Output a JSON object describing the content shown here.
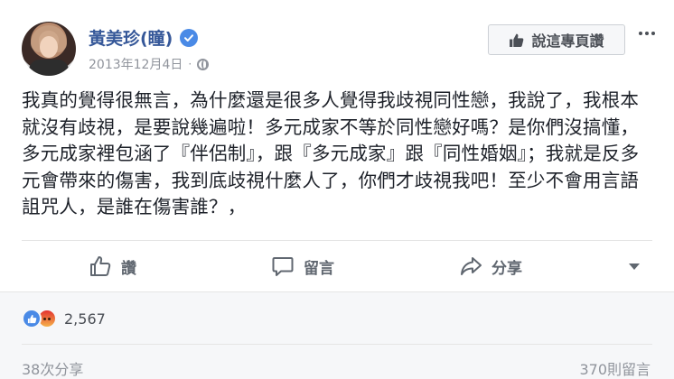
{
  "page": {
    "name": "黃美珍(瞳)",
    "date": "2013年12月4日",
    "separator": "·",
    "like_page_label": "說這專頁讚"
  },
  "post": {
    "text": "我真的覺得很無言，為什麼還是很多人覺得我歧視同性戀，我說了，我根本就沒有歧視，是要說幾遍啦！多元成家不等於同性戀好嗎？是你們沒搞懂，多元成家裡包涵了『伴侶制』，跟『多元成家』跟『同性婚姻』；我就是反多元會帶來的傷害，我到底歧視什麼人了，你們才歧視我吧！至少不會用言語詛咒人，是誰在傷害誰？，"
  },
  "actions": {
    "like": "讚",
    "comment": "留言",
    "share": "分享"
  },
  "stats": {
    "reactions_count": "2,567",
    "shares": "38次分享",
    "comments": "370則留言"
  },
  "icons": {
    "verified": "verified-badge-icon",
    "globe": "globe-icon",
    "thumbs_up": "thumbs-up-icon",
    "comment": "comment-bubble-icon",
    "share": "share-arrow-icon",
    "angry": "angry-reaction-icon"
  },
  "colors": {
    "name_link": "#365899",
    "verified_blue": "#4a8ae6",
    "meta_gray": "#90949c",
    "action_gray": "#606770"
  }
}
